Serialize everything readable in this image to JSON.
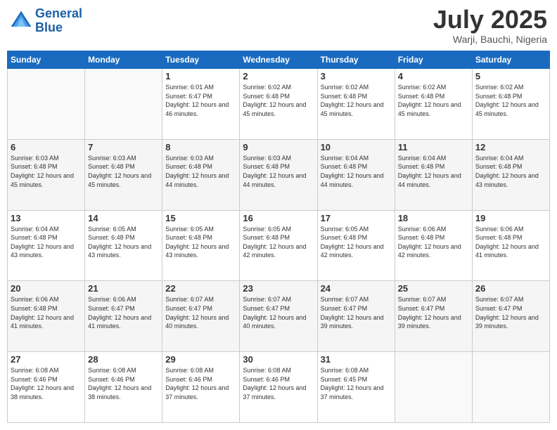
{
  "header": {
    "logo_general": "General",
    "logo_blue": "Blue",
    "month_title": "July 2025",
    "location": "Warji, Bauchi, Nigeria"
  },
  "days_of_week": [
    "Sunday",
    "Monday",
    "Tuesday",
    "Wednesday",
    "Thursday",
    "Friday",
    "Saturday"
  ],
  "weeks": [
    [
      {
        "day": "",
        "info": ""
      },
      {
        "day": "",
        "info": ""
      },
      {
        "day": "1",
        "info": "Sunrise: 6:01 AM\nSunset: 6:47 PM\nDaylight: 12 hours and 46 minutes."
      },
      {
        "day": "2",
        "info": "Sunrise: 6:02 AM\nSunset: 6:48 PM\nDaylight: 12 hours and 45 minutes."
      },
      {
        "day": "3",
        "info": "Sunrise: 6:02 AM\nSunset: 6:48 PM\nDaylight: 12 hours and 45 minutes."
      },
      {
        "day": "4",
        "info": "Sunrise: 6:02 AM\nSunset: 6:48 PM\nDaylight: 12 hours and 45 minutes."
      },
      {
        "day": "5",
        "info": "Sunrise: 6:02 AM\nSunset: 6:48 PM\nDaylight: 12 hours and 45 minutes."
      }
    ],
    [
      {
        "day": "6",
        "info": "Sunrise: 6:03 AM\nSunset: 6:48 PM\nDaylight: 12 hours and 45 minutes."
      },
      {
        "day": "7",
        "info": "Sunrise: 6:03 AM\nSunset: 6:48 PM\nDaylight: 12 hours and 45 minutes."
      },
      {
        "day": "8",
        "info": "Sunrise: 6:03 AM\nSunset: 6:48 PM\nDaylight: 12 hours and 44 minutes."
      },
      {
        "day": "9",
        "info": "Sunrise: 6:03 AM\nSunset: 6:48 PM\nDaylight: 12 hours and 44 minutes."
      },
      {
        "day": "10",
        "info": "Sunrise: 6:04 AM\nSunset: 6:48 PM\nDaylight: 12 hours and 44 minutes."
      },
      {
        "day": "11",
        "info": "Sunrise: 6:04 AM\nSunset: 6:48 PM\nDaylight: 12 hours and 44 minutes."
      },
      {
        "day": "12",
        "info": "Sunrise: 6:04 AM\nSunset: 6:48 PM\nDaylight: 12 hours and 43 minutes."
      }
    ],
    [
      {
        "day": "13",
        "info": "Sunrise: 6:04 AM\nSunset: 6:48 PM\nDaylight: 12 hours and 43 minutes."
      },
      {
        "day": "14",
        "info": "Sunrise: 6:05 AM\nSunset: 6:48 PM\nDaylight: 12 hours and 43 minutes."
      },
      {
        "day": "15",
        "info": "Sunrise: 6:05 AM\nSunset: 6:48 PM\nDaylight: 12 hours and 43 minutes."
      },
      {
        "day": "16",
        "info": "Sunrise: 6:05 AM\nSunset: 6:48 PM\nDaylight: 12 hours and 42 minutes."
      },
      {
        "day": "17",
        "info": "Sunrise: 6:05 AM\nSunset: 6:48 PM\nDaylight: 12 hours and 42 minutes."
      },
      {
        "day": "18",
        "info": "Sunrise: 6:06 AM\nSunset: 6:48 PM\nDaylight: 12 hours and 42 minutes."
      },
      {
        "day": "19",
        "info": "Sunrise: 6:06 AM\nSunset: 6:48 PM\nDaylight: 12 hours and 41 minutes."
      }
    ],
    [
      {
        "day": "20",
        "info": "Sunrise: 6:06 AM\nSunset: 6:48 PM\nDaylight: 12 hours and 41 minutes."
      },
      {
        "day": "21",
        "info": "Sunrise: 6:06 AM\nSunset: 6:47 PM\nDaylight: 12 hours and 41 minutes."
      },
      {
        "day": "22",
        "info": "Sunrise: 6:07 AM\nSunset: 6:47 PM\nDaylight: 12 hours and 40 minutes."
      },
      {
        "day": "23",
        "info": "Sunrise: 6:07 AM\nSunset: 6:47 PM\nDaylight: 12 hours and 40 minutes."
      },
      {
        "day": "24",
        "info": "Sunrise: 6:07 AM\nSunset: 6:47 PM\nDaylight: 12 hours and 39 minutes."
      },
      {
        "day": "25",
        "info": "Sunrise: 6:07 AM\nSunset: 6:47 PM\nDaylight: 12 hours and 39 minutes."
      },
      {
        "day": "26",
        "info": "Sunrise: 6:07 AM\nSunset: 6:47 PM\nDaylight: 12 hours and 39 minutes."
      }
    ],
    [
      {
        "day": "27",
        "info": "Sunrise: 6:08 AM\nSunset: 6:46 PM\nDaylight: 12 hours and 38 minutes."
      },
      {
        "day": "28",
        "info": "Sunrise: 6:08 AM\nSunset: 6:46 PM\nDaylight: 12 hours and 38 minutes."
      },
      {
        "day": "29",
        "info": "Sunrise: 6:08 AM\nSunset: 6:46 PM\nDaylight: 12 hours and 37 minutes."
      },
      {
        "day": "30",
        "info": "Sunrise: 6:08 AM\nSunset: 6:46 PM\nDaylight: 12 hours and 37 minutes."
      },
      {
        "day": "31",
        "info": "Sunrise: 6:08 AM\nSunset: 6:45 PM\nDaylight: 12 hours and 37 minutes."
      },
      {
        "day": "",
        "info": ""
      },
      {
        "day": "",
        "info": ""
      }
    ]
  ]
}
